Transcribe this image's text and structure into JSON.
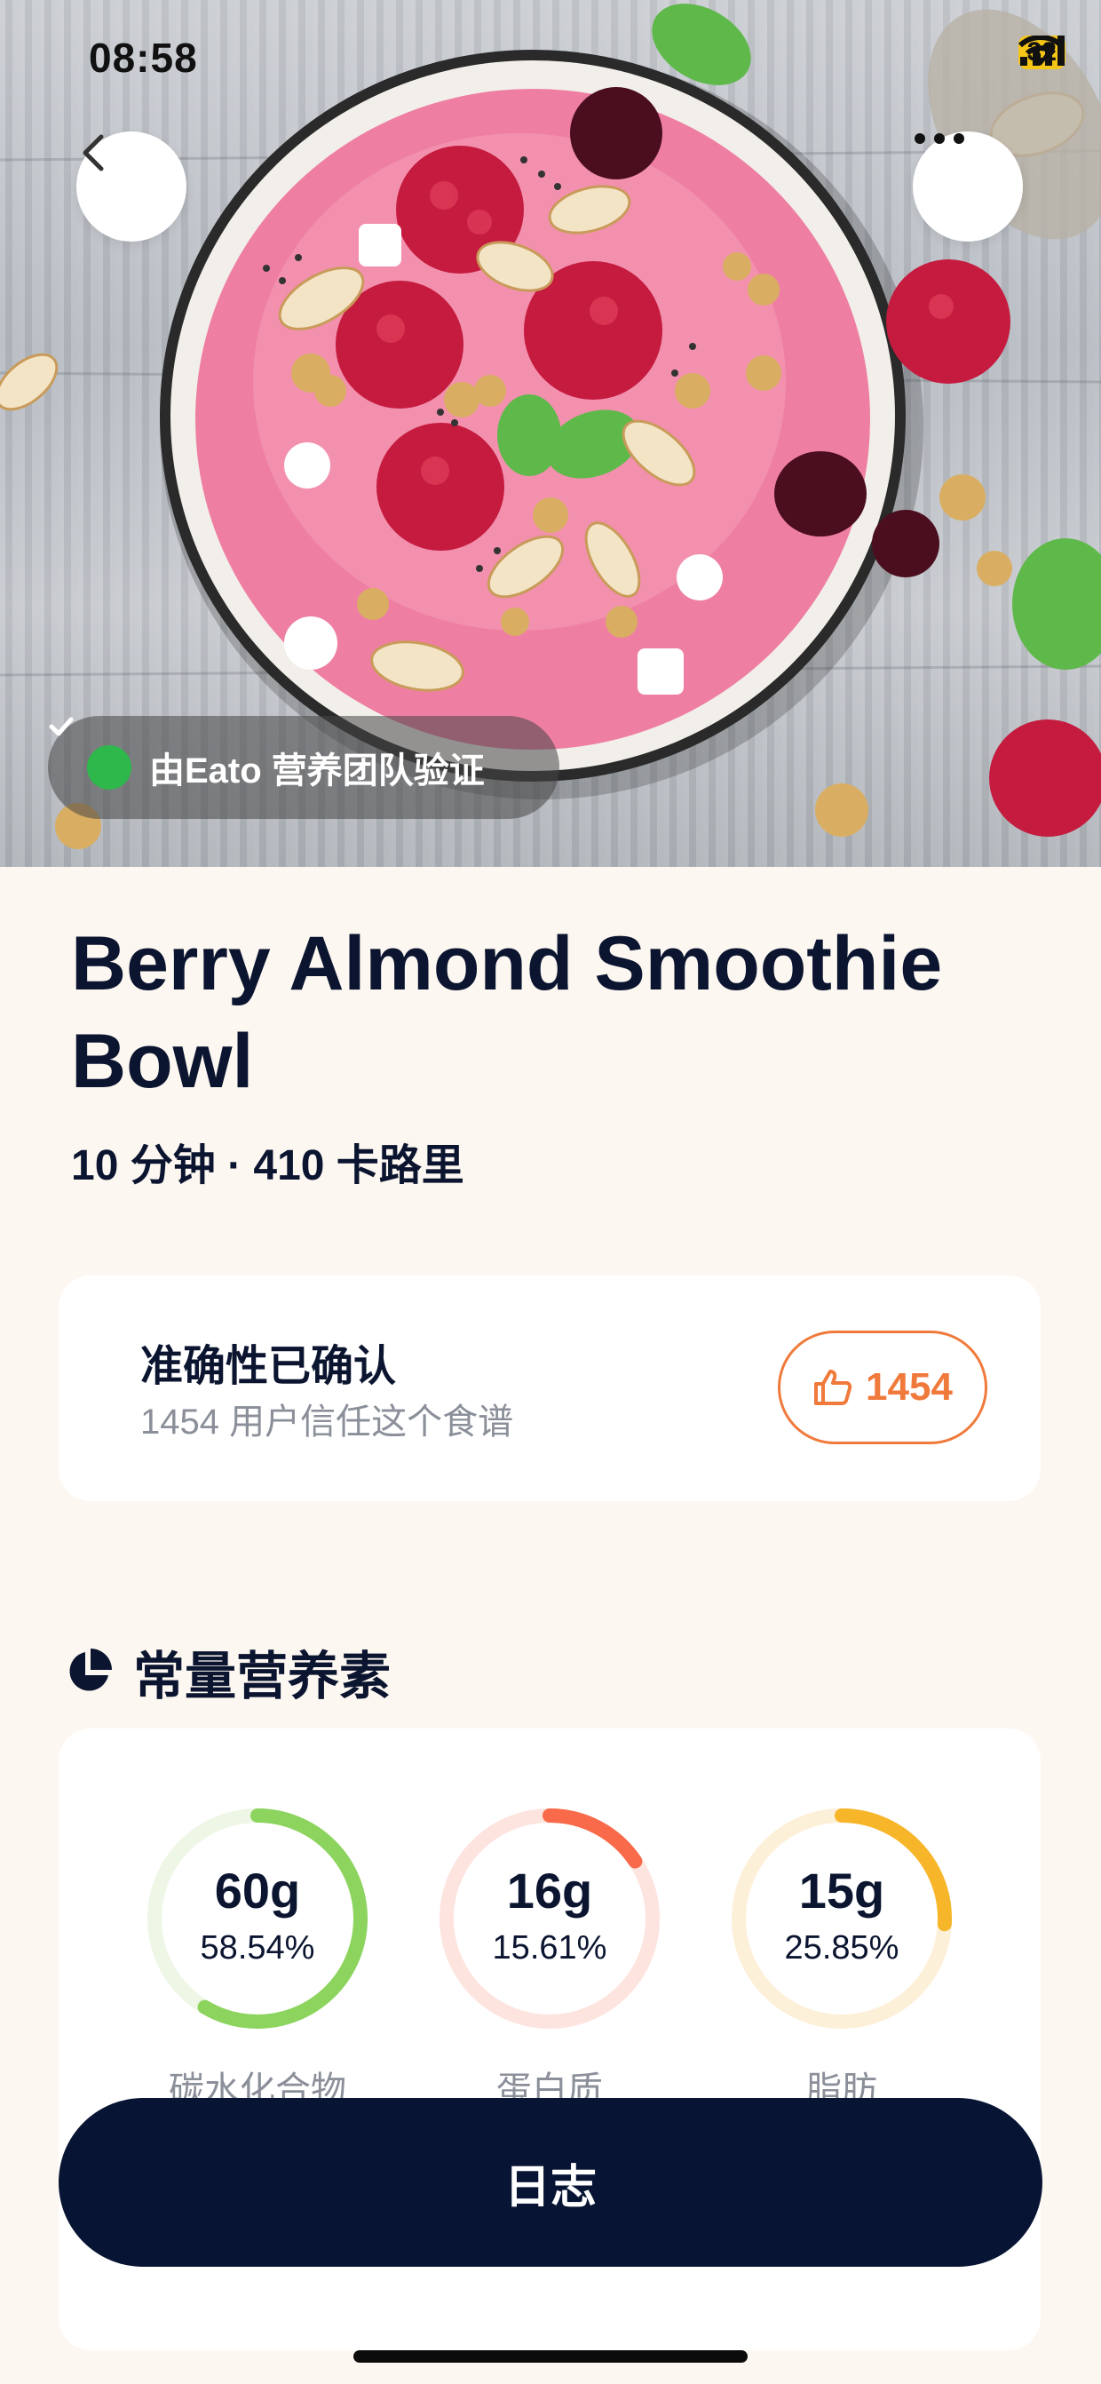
{
  "status_bar": {
    "time": "08:58",
    "battery": "32"
  },
  "hero": {
    "verified_label": "由Eato 营养团队验证"
  },
  "recipe": {
    "title": "Berry Almond Smoothie Bowl",
    "meta": "10 分钟 · 410 卡路里"
  },
  "trust": {
    "title": "准确性已确认",
    "subtitle": "1454 用户信任这个食谱",
    "likes": "1454"
  },
  "macros": {
    "section_title": "常量营养素",
    "items": [
      {
        "grams": "60g",
        "percent": "58.54%",
        "name": "碳水化合物",
        "fraction": 0.5854,
        "color": "#8DD45E",
        "track": "#EEF6E6"
      },
      {
        "grams": "16g",
        "percent": "15.61%",
        "name": "蛋白质",
        "fraction": 0.1561,
        "color": "#F86A4A",
        "track": "#FDE4DF"
      },
      {
        "grams": "15g",
        "percent": "25.85%",
        "name": "脂肪",
        "fraction": 0.2585,
        "color": "#F7B52A",
        "track": "#FDF0D8"
      }
    ]
  },
  "actions": {
    "log_label": "日志"
  }
}
